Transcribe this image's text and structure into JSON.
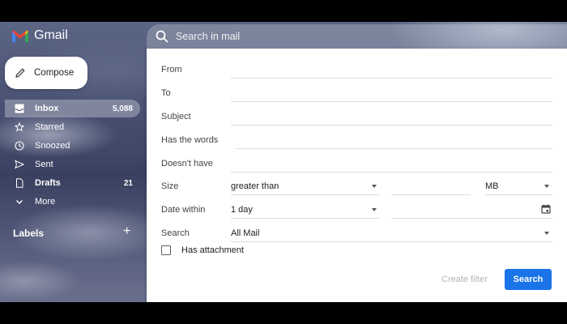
{
  "header": {
    "brand": "Gmail",
    "search_placeholder": "Search in mail"
  },
  "sidebar": {
    "compose_label": "Compose",
    "items": [
      {
        "label": "Inbox",
        "count": "5,088",
        "icon": "inbox-icon"
      },
      {
        "label": "Starred",
        "count": "",
        "icon": "star-icon"
      },
      {
        "label": "Snoozed",
        "count": "",
        "icon": "clock-icon"
      },
      {
        "label": "Sent",
        "count": "",
        "icon": "send-icon"
      },
      {
        "label": "Drafts",
        "count": "21",
        "icon": "draft-icon"
      },
      {
        "label": "More",
        "count": "",
        "icon": "chevron-down-icon"
      }
    ],
    "labels_title": "Labels",
    "labels_add": "+"
  },
  "advanced_search": {
    "from_label": "From",
    "to_label": "To",
    "subject_label": "Subject",
    "has_words_label": "Has the words",
    "doesnt_have_label": "Doesn't have",
    "size_label": "Size",
    "size_operator": "greater than",
    "size_unit": "MB",
    "date_within_label": "Date within",
    "date_within_value": "1 day",
    "search_label": "Search",
    "search_scope": "All Mail",
    "has_attachment_label": "Has attachment",
    "create_filter_label": "Create filter",
    "search_button_label": "Search"
  },
  "colors": {
    "primary_button": "#1a73e8",
    "panel_bg": "#ffffff"
  }
}
